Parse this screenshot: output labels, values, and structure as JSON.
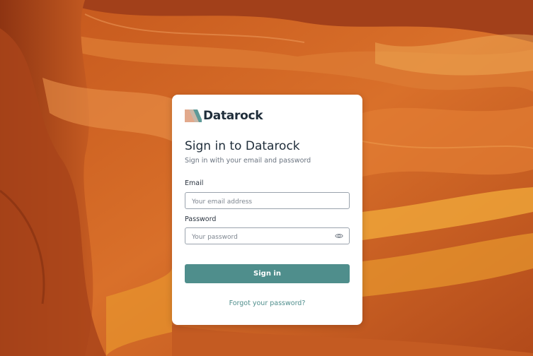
{
  "colors": {
    "accent": "#4f8e8c",
    "title": "#1f2d3a",
    "card_bg": "#ffffff",
    "background_rock": "#b8501d"
  },
  "brand": {
    "name": "Datarock",
    "logo_icon": "datarock-logo-icon"
  },
  "login": {
    "title": "Sign in to Datarock",
    "subtitle": "Sign in with your email and password",
    "email_label": "Email",
    "email_placeholder": "Your email address",
    "email_value": "",
    "password_label": "Password",
    "password_placeholder": "Your password",
    "password_value": "",
    "password_toggle_icon": "eye-icon",
    "submit_label": "Sign in",
    "forgot_label": "Forgot your password?"
  },
  "background": {
    "description_icon": "canyon-background-image"
  }
}
